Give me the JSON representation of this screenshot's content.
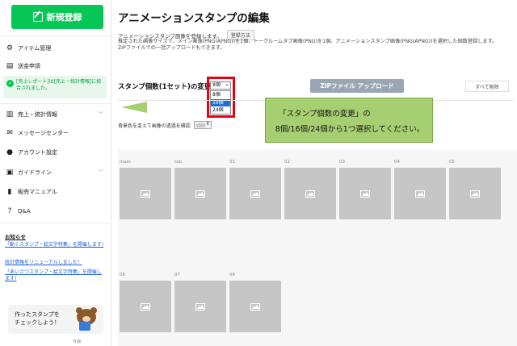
{
  "sidebar": {
    "new_button": "新規登録",
    "items": [
      {
        "label": "アイテム管理",
        "icon": "gear-icon"
      },
      {
        "label": "送金申請",
        "icon": "database-icon"
      },
      {
        "label": "売上・統計情報",
        "icon": "chart-icon"
      },
      {
        "label": "メッセージセンター",
        "icon": "mail-icon"
      },
      {
        "label": "アカウント設定",
        "icon": "person-icon"
      },
      {
        "label": "ガイドライン",
        "icon": "document-icon"
      },
      {
        "label": "販売マニュアル",
        "icon": "book-icon"
      },
      {
        "label": "Q&A",
        "icon": "question-icon"
      }
    ],
    "alert": "[売上レポート]は[売上・統計情報]に統合されました。",
    "notice_title": "お知らせ",
    "notices": [
      "「動くスタンプ・絵文字特集」を開催します!",
      "統計情報をリニューアルしました！",
      "「あいさつスタンプ・絵文字特集」を開催します!"
    ],
    "banner": "作ったスタンプを\nチェックしよう！",
    "bottom_text": "今週"
  },
  "main": {
    "title": "アニメーションスタンプの編集",
    "subtitle": "アニメーションスタンプ画像を登録します。",
    "how_button": "登録方法",
    "description": "推定された画像サイズで、メイン画像(PNG(APNG))を1個、トークルームタブ画像(PNG)を1個、アニメーションスタンプ画像(PNG(APNG))を選択した個数登録します。\nZIPファイルでの一括アップロードもできます。",
    "count_label": "スタンプ個数(1セット)の変更",
    "count_selected": "8個",
    "count_options": [
      "8個",
      "16個",
      "24個"
    ],
    "zip_button": "ZIPファイル アップロード",
    "delete_all_button": "すべて削除",
    "bg_label": "背景色を変えて画像の透過を確認"
  },
  "callout": {
    "line1": "「スタンプ個数の変更」の",
    "line2": "8個/16個/24個から1つ選択してください。",
    "color": "#a6cf72"
  },
  "grid": {
    "row1": [
      "main",
      "tab",
      "01",
      "02",
      "03",
      "04",
      "05"
    ],
    "row2": [
      "06",
      "07",
      "08"
    ]
  },
  "colors": {
    "accent_green": "#06c755",
    "highlight_red": "#e60012",
    "selected_blue": "#1e6fd9"
  }
}
